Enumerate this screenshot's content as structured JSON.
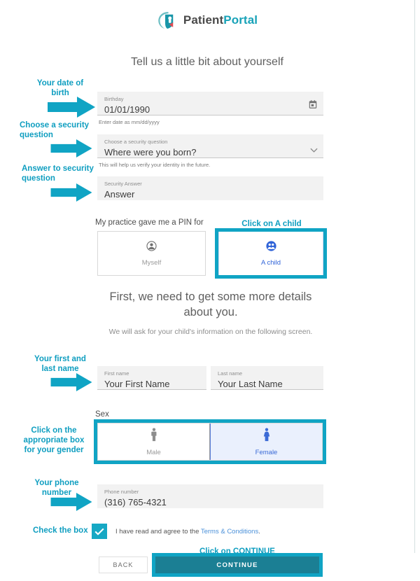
{
  "brand": {
    "name_part1": "Patient",
    "name_part2": "Portal",
    "logo_icon": "patient-portal-logo-icon",
    "teal": "#17a2b8",
    "dark": "#4a4a4a",
    "red": "#e24a52"
  },
  "headings": {
    "main": "Tell us a little bit about yourself",
    "sub": "First, we need to get some more details about you.",
    "note": "We will ask for your child's information on the following screen."
  },
  "fields": {
    "birthday": {
      "label": "Birthday",
      "value": "01/01/1990",
      "helper": "Enter date as mm/dd/yyyy",
      "icon": "calendar-icon"
    },
    "security_question": {
      "label": "Choose a security question",
      "value": "Where were you born?",
      "helper": "This will help us verify your identity in the future.",
      "icon": "chevron-down-icon",
      "options": [
        "Where were you born?"
      ]
    },
    "security_answer": {
      "label": "Security Answer",
      "value": "Answer"
    },
    "first_name": {
      "label": "First name",
      "value": "Your First Name"
    },
    "last_name": {
      "label": "Last name",
      "value": "Your Last Name"
    },
    "phone": {
      "label": "Phone number",
      "value": "(316) 765-4321"
    }
  },
  "pin_section": {
    "label": "My practice gave me a PIN for",
    "options": [
      {
        "label": "Myself",
        "icon": "account-circle-icon",
        "selected": false
      },
      {
        "label": "A child",
        "icon": "people-circle-icon",
        "selected": true
      }
    ]
  },
  "sex_section": {
    "label": "Sex",
    "options": [
      {
        "label": "Male",
        "icon": "male-figure-icon",
        "selected": false
      },
      {
        "label": "Female",
        "icon": "female-figure-icon",
        "selected": true
      }
    ]
  },
  "terms": {
    "checked": true,
    "text_before": "I have read and agree to the ",
    "link": "Terms & Conditions",
    "text_after": "."
  },
  "buttons": {
    "back": "BACK",
    "continue": "CONTINUE"
  },
  "annotations": {
    "accent": "#10a4c4",
    "dob": "Your date of\nbirth",
    "dob_line1": "Your date of",
    "dob_line2": "birth",
    "security_question_line1": "Choose a security",
    "security_question_line2": "question",
    "security_answer_line1": "Answer to security",
    "security_answer_line2": "question",
    "child": "Click on A child",
    "name_line1": "Your first and",
    "name_line2": "last name",
    "gender_line1": "Click on the",
    "gender_line2": "appropriate box",
    "gender_line3": "for your gender",
    "phone_line1": "Your phone",
    "phone_line2": "number",
    "checkbox": "Check the box",
    "continue": "Click on CONTINUE"
  }
}
